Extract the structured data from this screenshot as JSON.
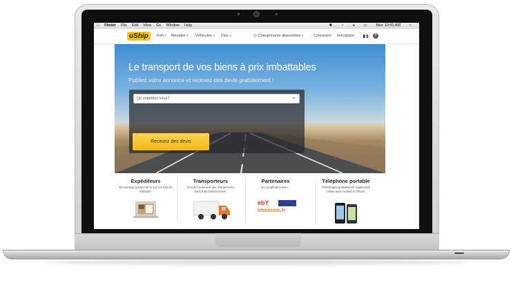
{
  "menubar": {
    "apple": "",
    "items": [
      "Finder",
      "File",
      "Edit",
      "View",
      "Go",
      "Window",
      "Help"
    ],
    "clock": "Mon 10:50 AM"
  },
  "site": {
    "logo": "uShip",
    "nav": [
      "Fret",
      "Meubles",
      "Véhicules",
      "Plus"
    ],
    "right_links": [
      "Chargements disponibles",
      "Connexion",
      "Inscription"
    ],
    "help": "?"
  },
  "hero": {
    "title": "Le transport de vos biens à prix imbattables",
    "subtitle": "Publiez votre annonce et recevez des devis gratuitement !",
    "search_placeholder": "Qu expédiez-vous?",
    "cta": "Recevez des devis"
  },
  "features": [
    {
      "title": "Expéditeurs",
      "text": "Économisez jusqu'à 80 % sur vos frais de transport.",
      "icon": "laptop-screenshot-icon"
    },
    {
      "title": "Transporteurs",
      "text": "Trouvez facilement des chargements. Sans frais d'abonnement.",
      "icon": "delivery-truck-icon"
    },
    {
      "title": "Partenaires",
      "text": "En coopération avec :",
      "icon": "partner-logos-icon",
      "partners": [
        "ebY",
        "leboncoin.fr"
      ]
    },
    {
      "title": "Téléphone portable",
      "text": "Téléchargez gratuitement l'application mobile pour Android et iPhone.",
      "icon": "smartphone-icon"
    }
  ],
  "colors": {
    "accent": "#f2b619",
    "sky": "#3f8ed2"
  }
}
